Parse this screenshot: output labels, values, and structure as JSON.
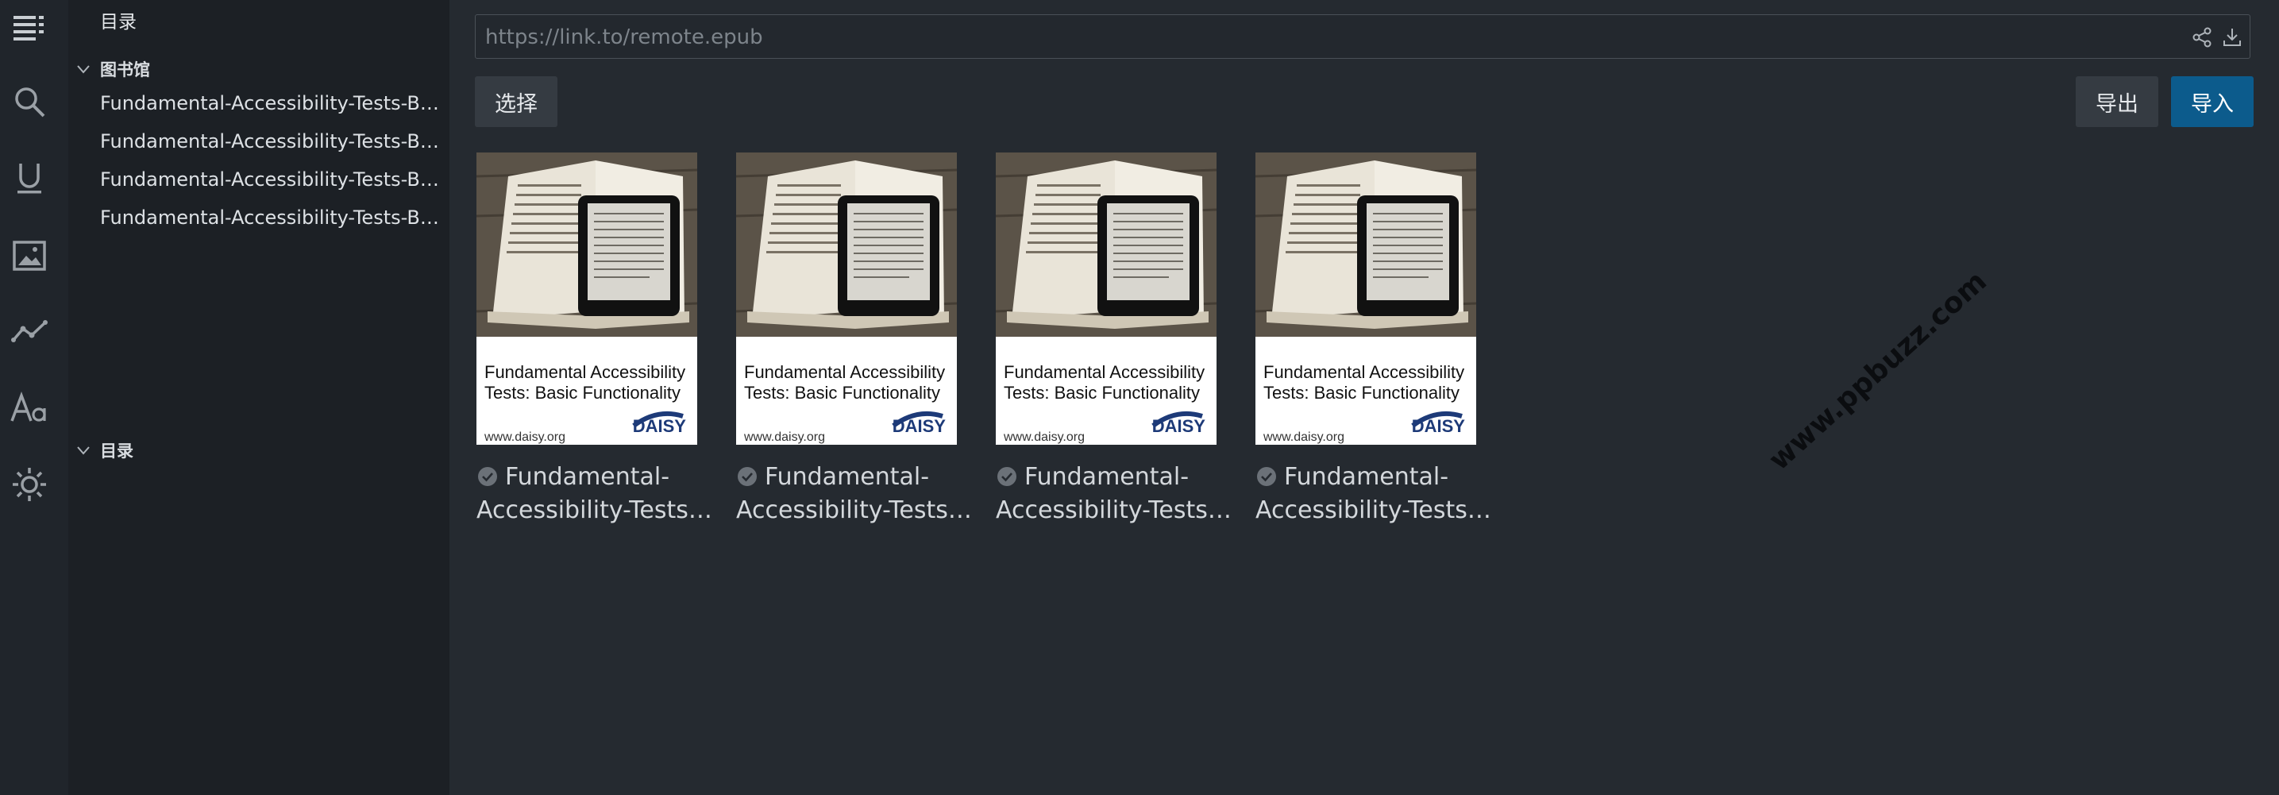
{
  "activity_bar": {
    "icons": [
      "menu-icon",
      "search-icon",
      "underline-icon",
      "image-icon",
      "chart-line-icon",
      "font-icon",
      "sun-icon"
    ]
  },
  "sidebar": {
    "title": "目录",
    "library_section": "图书馆",
    "items": [
      {
        "label": "Fundamental-Accessibility-Tests-Basic-Functionality"
      },
      {
        "label": "Fundamental-Accessibility-Tests-Basic-Functionality"
      },
      {
        "label": "Fundamental-Accessibility-Tests-Basic-Functionality"
      },
      {
        "label": "Fundamental-Accessibility-Tests-Basic-Functionality"
      }
    ],
    "toc_section": "目录"
  },
  "toolbar": {
    "url_placeholder": "https://link.to/remote.epub",
    "select_label": "选择",
    "export_label": "导出",
    "import_label": "导入"
  },
  "books": [
    {
      "cover_title": "Fundamental Accessibility Tests: Basic Functionality",
      "cover_url": "www.daisy.org",
      "cover_logo": "DAISY",
      "title_line1": "Fundamental-",
      "title_line2": "Accessibility-Tests-Basic-Functionality"
    },
    {
      "cover_title": "Fundamental Accessibility Tests: Basic Functionality",
      "cover_url": "www.daisy.org",
      "cover_logo": "DAISY",
      "title_line1": "Fundamental-",
      "title_line2": "Accessibility-Tests-Basic-Functionality"
    },
    {
      "cover_title": "Fundamental Accessibility Tests: Basic Functionality",
      "cover_url": "www.daisy.org",
      "cover_logo": "DAISY",
      "title_line1": "Fundamental-",
      "title_line2": "Accessibility-Tests-Basic-Functionality"
    },
    {
      "cover_title": "Fundamental Accessibility Tests: Basic Functionality",
      "cover_url": "www.daisy.org",
      "cover_logo": "DAISY",
      "title_line1": "Fundamental-",
      "title_line2": "Accessibility-Tests-Basic-Functionality"
    }
  ],
  "watermark": "www.ppbuzz.com",
  "colors": {
    "primary": "#0c5b8c",
    "background": "#252a30",
    "sidebar": "#1c2025"
  }
}
